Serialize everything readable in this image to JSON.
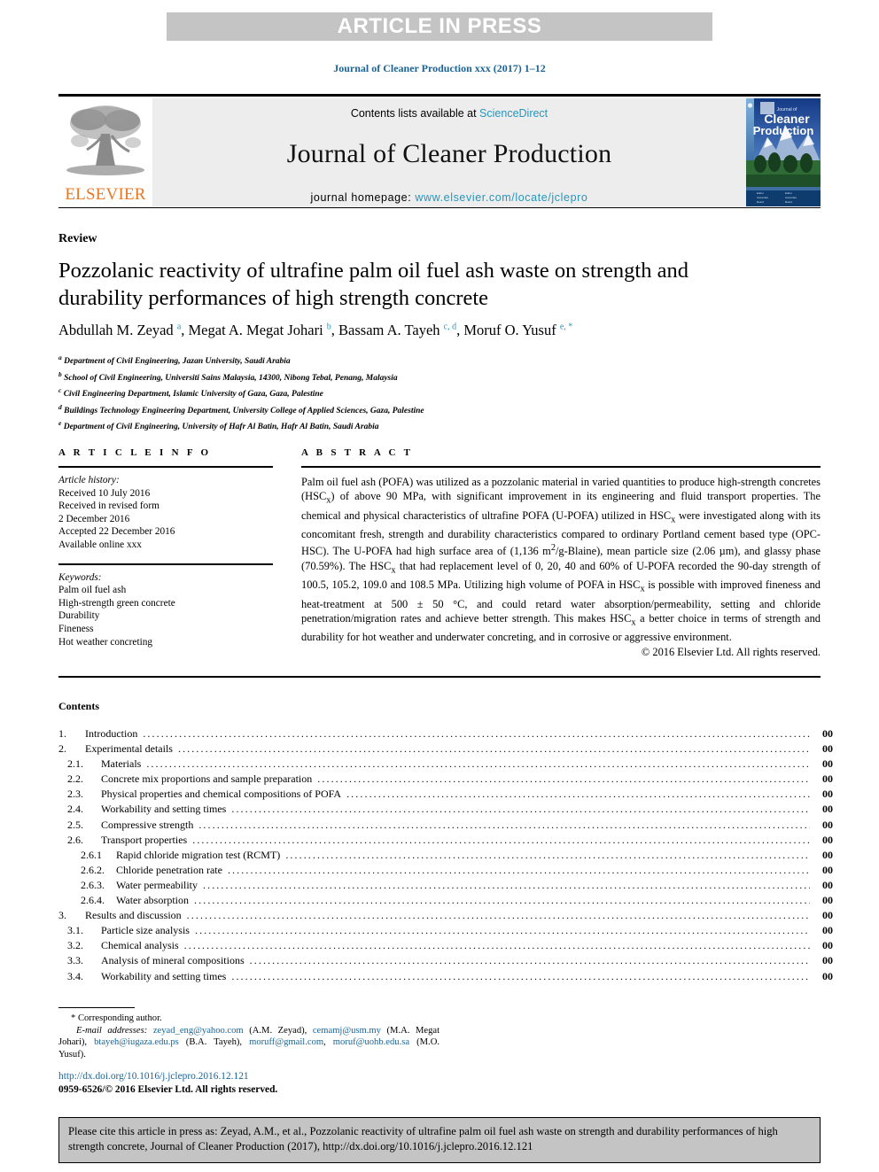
{
  "banner": {
    "text": "ARTICLE IN PRESS"
  },
  "running_head": "Journal of Cleaner Production xxx (2017) 1–12",
  "masthead": {
    "contents_prefix": "Contents lists available at ",
    "sciencedirect": "ScienceDirect",
    "journal_title": "Journal of Cleaner Production",
    "homepage_prefix": "journal homepage: ",
    "homepage_url": "www.elsevier.com/locate/jclepro",
    "publisher": "ELSEVIER",
    "cover_title_small": "Journal of",
    "cover_title_line1": "Cleaner",
    "cover_title_line2": "Production",
    "link_color": "#2596be",
    "panel_bg": "#ededed"
  },
  "article": {
    "doctype": "Review",
    "title": "Pozzolanic reactivity of ultrafine palm oil fuel ash waste on strength and durability performances of high strength concrete",
    "authors_html": "Abdullah M. Zeyad <sup>a</sup>, Megat A. Megat Johari <sup>b</sup>, Bassam A. Tayeh <sup>c, d</sup>, Moruf O. Yusuf <sup>e, *</sup>",
    "affiliations": [
      {
        "marker": "a",
        "text": "Department of Civil Engineering, Jazan University, Saudi Arabia"
      },
      {
        "marker": "b",
        "text": "School of Civil Engineering, Universiti Sains Malaysia, 14300, Nibong Tebal, Penang, Malaysia"
      },
      {
        "marker": "c",
        "text": "Civil Engineering Department, Islamic University of Gaza, Gaza, Palestine"
      },
      {
        "marker": "d",
        "text": "Buildings Technology Engineering Department, University College of Applied Sciences, Gaza, Palestine"
      },
      {
        "marker": "e",
        "text": "Department of Civil Engineering, University of Hafr Al Batin, Hafr Al Batin, Saudi Arabia"
      }
    ]
  },
  "article_info": {
    "heading": "A R T I C L E  I N F O",
    "history_label": "Article history:",
    "history": [
      "Received 10 July 2016",
      "Received in revised form",
      "2 December 2016",
      "Accepted 22 December 2016",
      "Available online xxx"
    ],
    "keywords_label": "Keywords:",
    "keywords": [
      "Palm oil fuel ash",
      "High-strength green concrete",
      "Durability",
      "Fineness",
      "Hot weather concreting"
    ]
  },
  "abstract": {
    "heading": "A B S T R A C T",
    "body_html": "Palm oil fuel ash (POFA) was utilized as a pozzolanic material in varied quantities to produce high-strength concretes (HSC<sub>x</sub>) of above 90 MPa, with significant improvement in its engineering and fluid transport properties. The chemical and physical characteristics of ultrafine POFA (U-POFA) utilized in HSC<sub>x</sub> were investigated along with its concomitant fresh, strength and durability characteristics compared to ordinary Portland cement based type (OPC-HSC). The U-POFA had high surface area of (1,136 m<sup>2</sup>/g-Blaine), mean particle size (2.06 &micro;m), and glassy phase (70.59%). The HSC<sub>x</sub> that had replacement level of 0, 20, 40 and 60% of U-POFA recorded the 90-day strength of 100.5, 105.2, 109.0 and 108.5 MPa. Utilizing high volume of POFA in HSC<sub>x</sub> is possible with improved fineness and heat-treatment at 500 &plusmn; 50 &deg;C, and could retard water absorption/permeability, setting and chloride penetration/migration rates and achieve better strength. This makes HSC<sub>x</sub> a better choice in terms of strength and durability for hot weather and underwater concreting, and in corrosive or aggressive environment.",
    "copyright": "© 2016 Elsevier Ltd. All rights reserved."
  },
  "contents": {
    "heading": "Contents",
    "entries": [
      {
        "level": 0,
        "num": "1.",
        "label": "Introduction",
        "page": "00"
      },
      {
        "level": 0,
        "num": "2.",
        "label": "Experimental details",
        "page": "00"
      },
      {
        "level": 1,
        "num": "2.1.",
        "label": "Materials",
        "page": "00"
      },
      {
        "level": 1,
        "num": "2.2.",
        "label": "Concrete mix proportions and sample preparation",
        "page": "00"
      },
      {
        "level": 1,
        "num": "2.3.",
        "label": "Physical properties and chemical compositions of POFA",
        "page": "00"
      },
      {
        "level": 1,
        "num": "2.4.",
        "label": "Workability and setting times",
        "page": "00"
      },
      {
        "level": 1,
        "num": "2.5.",
        "label": "Compressive strength",
        "page": "00"
      },
      {
        "level": 1,
        "num": "2.6.",
        "label": "Transport properties",
        "page": "00"
      },
      {
        "level": 2,
        "num": "2.6.1",
        "label": "Rapid chloride migration test (RCMT)",
        "page": "00"
      },
      {
        "level": 2,
        "num": "2.6.2.",
        "label": "Chloride penetration rate",
        "page": "00"
      },
      {
        "level": 2,
        "num": "2.6.3.",
        "label": "Water permeability",
        "page": "00"
      },
      {
        "level": 2,
        "num": "2.6.4.",
        "label": "Water absorption",
        "page": "00"
      },
      {
        "level": 0,
        "num": "3.",
        "label": "Results and discussion",
        "page": "00"
      },
      {
        "level": 1,
        "num": "3.1.",
        "label": "Particle size analysis",
        "page": "00"
      },
      {
        "level": 1,
        "num": "3.2.",
        "label": "Chemical analysis",
        "page": "00"
      },
      {
        "level": 1,
        "num": "3.3.",
        "label": "Analysis of mineral compositions",
        "page": "00"
      },
      {
        "level": 1,
        "num": "3.4.",
        "label": "Workability and setting times",
        "page": "00"
      }
    ]
  },
  "footnotes": {
    "corresponding": "* Corresponding author.",
    "emails_label": "E-mail addresses:",
    "emails": [
      {
        "address": "zeyad_eng@yahoo.com",
        "owner": "(A.M. Zeyad),"
      },
      {
        "address": "cemamj@usm.my",
        "owner": "(M.A. Megat Johari),"
      },
      {
        "address": "btayeh@iugaza.edu.ps",
        "owner": "(B.A. Tayeh),"
      },
      {
        "address": "moruff@gmail.com",
        "owner": ","
      },
      {
        "address": "moruf@uohb.edu.sa",
        "owner": "(M.O. Yusuf)."
      }
    ],
    "doi_url": "http://dx.doi.org/10.1016/j.jclepro.2016.12.121",
    "issn_line": "0959-6526/© 2016 Elsevier Ltd. All rights reserved."
  },
  "cite_box": {
    "text": "Please cite this article in press as: Zeyad, A.M., et al., Pozzolanic reactivity of ultrafine palm oil fuel ash waste on strength and durability performances of high strength concrete, Journal of Cleaner Production (2017), http://dx.doi.org/10.1016/j.jclepro.2016.12.121",
    "bg": "#c4c4c4"
  }
}
